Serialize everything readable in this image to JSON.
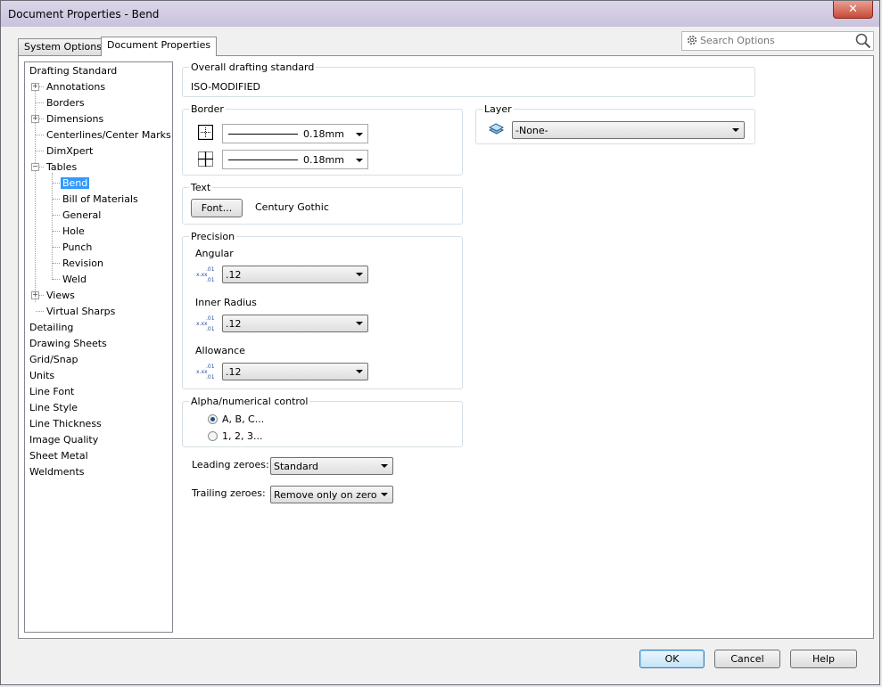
{
  "window": {
    "title": "Document Properties - Bend",
    "close_label": "✕"
  },
  "tabs": [
    {
      "label": "System Options"
    },
    {
      "label": "Document Properties"
    }
  ],
  "search": {
    "placeholder": "Search Options"
  },
  "tree": {
    "items": [
      {
        "label": "Drafting Standard"
      },
      {
        "label": "Annotations"
      },
      {
        "label": "Borders"
      },
      {
        "label": "Dimensions"
      },
      {
        "label": "Centerlines/Center Marks"
      },
      {
        "label": "DimXpert"
      },
      {
        "label": "Tables"
      },
      {
        "label": "Bend"
      },
      {
        "label": "Bill of Materials"
      },
      {
        "label": "General"
      },
      {
        "label": "Hole"
      },
      {
        "label": "Punch"
      },
      {
        "label": "Revision"
      },
      {
        "label": "Weld"
      },
      {
        "label": "Views"
      },
      {
        "label": "Virtual Sharps"
      },
      {
        "label": "Detailing"
      },
      {
        "label": "Drawing Sheets"
      },
      {
        "label": "Grid/Snap"
      },
      {
        "label": "Units"
      },
      {
        "label": "Line Font"
      },
      {
        "label": "Line Style"
      },
      {
        "label": "Line Thickness"
      },
      {
        "label": "Image Quality"
      },
      {
        "label": "Sheet Metal"
      },
      {
        "label": "Weldments"
      }
    ],
    "selected": "Bend"
  },
  "overall": {
    "title": "Overall drafting standard",
    "value": "ISO-MODIFIED"
  },
  "border": {
    "title": "Border",
    "outer_value": "0.18mm",
    "inner_value": "0.18mm"
  },
  "layer": {
    "title": "Layer",
    "value": "-None-"
  },
  "text": {
    "title": "Text",
    "font_button": "Font...",
    "font_name": "Century Gothic"
  },
  "precision": {
    "title": "Precision",
    "icon_text": {
      "top": ".01",
      "mid": "x.xx",
      "bot": ".01"
    },
    "angular": {
      "label": "Angular",
      "value": ".12"
    },
    "inner_radius": {
      "label": "Inner Radius",
      "value": ".12"
    },
    "allowance": {
      "label": "Allowance",
      "value": ".12"
    }
  },
  "alpha": {
    "title": "Alpha/numerical control",
    "option1": "A, B, C...",
    "option2": "1, 2, 3...",
    "selected": "A, B, C..."
  },
  "leading": {
    "label": "Leading zeroes:",
    "value": "Standard"
  },
  "trailing": {
    "label": "Trailing zeroes:",
    "value": "Remove only on zero"
  },
  "buttons": {
    "ok": "OK",
    "cancel": "Cancel",
    "help": "Help"
  }
}
